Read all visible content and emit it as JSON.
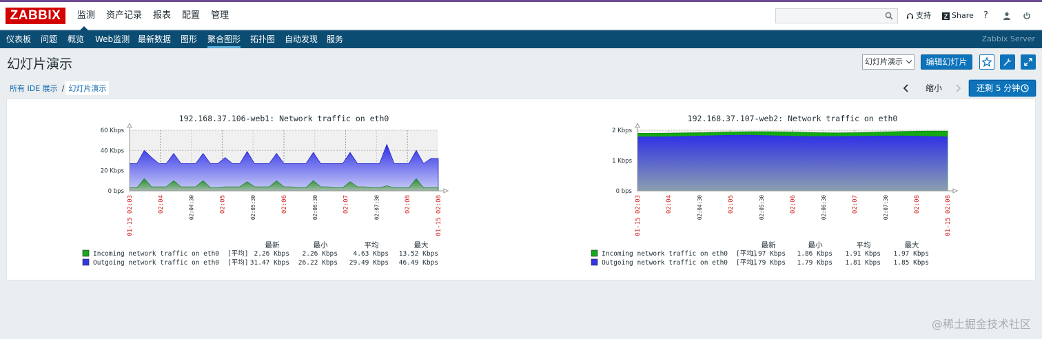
{
  "header": {
    "logo": "ZABBIX",
    "menu": [
      "监测",
      "资产记录",
      "报表",
      "配置",
      "管理"
    ],
    "search_value": "",
    "support": "支持",
    "share": "Share",
    "help": "?",
    "user_icon": "user-icon",
    "logout_icon": "power-icon"
  },
  "subnav": {
    "items": [
      "仪表板",
      "问题",
      "概览",
      "Web监测",
      "最新数据",
      "图形",
      "聚合图形",
      "拓扑图",
      "自动发现",
      "服务"
    ],
    "active": "聚合图形",
    "server": "Zabbix Server"
  },
  "page": {
    "title": "幻灯片演示",
    "select_value": "幻灯片演示",
    "edit_button": "编辑幻灯片",
    "fav_icon": "star-icon",
    "wrench_icon": "wrench-icon",
    "fullscreen_icon": "fullscreen-icon"
  },
  "breadcrumb": [
    "所有 IDE 展示",
    "幻灯片演示"
  ],
  "controls": {
    "zoom_out": "缩小",
    "timer": "还剩 5 分钟"
  },
  "watermark": "@稀土掘金技术社区",
  "legend_headers": [
    "最新",
    "最小",
    "平均",
    "最大"
  ],
  "chart_data": [
    {
      "type": "area",
      "title": "192.168.37.106-web1: Network traffic on eth0",
      "y_ticks": [
        "60 Kbps",
        "40 Kbps",
        "20 Kbps",
        "0 bps"
      ],
      "ylim": [
        0,
        60
      ],
      "x_ticks": [
        {
          "label": "01-15 02:03",
          "major": true
        },
        {
          "label": "02:04",
          "major": true
        },
        {
          "label": "02:04:30",
          "major": false
        },
        {
          "label": "02:05",
          "major": true
        },
        {
          "label": "02:05:30",
          "major": false
        },
        {
          "label": "02:06",
          "major": true
        },
        {
          "label": "02:06:30",
          "major": false
        },
        {
          "label": "02:07",
          "major": true
        },
        {
          "label": "02:07:30",
          "major": false
        },
        {
          "label": "02:08",
          "major": true
        },
        {
          "label": "01-15 02:08",
          "major": true
        }
      ],
      "series": [
        {
          "name": "Incoming network traffic on eth0",
          "color": "#1aa71a",
          "agg": "[平均]",
          "stats": [
            "2.26 Kbps",
            "2.26 Kbps",
            "4.63 Kbps",
            "13.52 Kbps"
          ],
          "values": [
            3,
            3,
            12,
            4,
            4,
            4,
            10,
            4,
            4,
            4,
            10,
            3,
            3,
            4,
            4,
            4,
            9,
            4,
            4,
            4,
            10,
            4,
            4,
            3,
            3,
            10,
            4,
            4,
            3,
            3,
            9,
            4,
            4,
            3,
            3,
            5,
            3,
            3,
            3,
            12,
            3,
            3,
            3
          ]
        },
        {
          "name": "Outgoing network traffic on eth0",
          "color": "#3535e8",
          "agg": "[平均]",
          "stats": [
            "31.47 Kbps",
            "26.22 Kbps",
            "29.49 Kbps",
            "46.49 Kbps"
          ],
          "values": [
            27,
            27,
            40,
            33,
            27,
            27,
            37,
            27,
            27,
            27,
            37,
            27,
            27,
            33,
            27,
            27,
            39,
            27,
            27,
            27,
            37,
            27,
            27,
            27,
            27,
            38,
            27,
            27,
            27,
            27,
            38,
            27,
            27,
            27,
            27,
            46,
            27,
            27,
            27,
            40,
            27,
            32,
            32
          ]
        }
      ]
    },
    {
      "type": "area",
      "title": "192.168.37.107-web2: Network traffic on eth0",
      "y_ticks": [
        "2 Kbps",
        "1 Kbps",
        "0 bps"
      ],
      "ylim": [
        0,
        2
      ],
      "x_ticks": [
        {
          "label": "01-15 02:03",
          "major": true
        },
        {
          "label": "02:04",
          "major": true
        },
        {
          "label": "02:04:30",
          "major": false
        },
        {
          "label": "02:05",
          "major": true
        },
        {
          "label": "02:05:30",
          "major": false
        },
        {
          "label": "02:06",
          "major": true
        },
        {
          "label": "02:06:30",
          "major": false
        },
        {
          "label": "02:07",
          "major": true
        },
        {
          "label": "02:07:30",
          "major": false
        },
        {
          "label": "02:08",
          "major": true
        },
        {
          "label": "01-15 02:08",
          "major": true
        }
      ],
      "series": [
        {
          "name": "Incoming network traffic on eth0",
          "color": "#1aa71a",
          "agg": "[平均]",
          "stats": [
            "1.97 Kbps",
            "1.86 Kbps",
            "1.91 Kbps",
            "1.97 Kbps"
          ],
          "values": [
            1.9,
            1.9,
            1.91,
            1.92,
            1.94,
            1.95,
            1.95,
            1.94,
            1.92,
            1.91,
            1.92,
            1.94,
            1.96,
            1.97,
            1.97
          ]
        },
        {
          "name": "Outgoing network traffic on eth0",
          "color": "#3535e8",
          "agg": "[平均]",
          "stats": [
            "1.79 Kbps",
            "1.79 Kbps",
            "1.81 Kbps",
            "1.85 Kbps"
          ],
          "values": [
            1.79,
            1.79,
            1.8,
            1.82,
            1.84,
            1.85,
            1.83,
            1.81,
            1.8,
            1.8,
            1.81,
            1.82,
            1.82,
            1.81,
            1.79
          ]
        }
      ]
    }
  ]
}
